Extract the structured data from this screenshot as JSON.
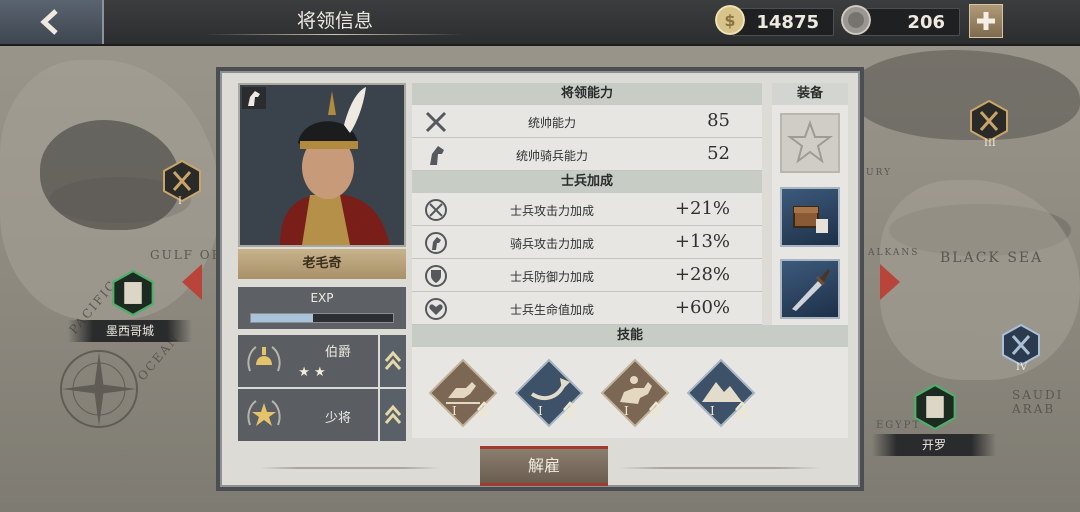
{
  "header": {
    "title": "将领信息"
  },
  "resources": {
    "gold": "14875",
    "silver": "206"
  },
  "cities": [
    {
      "label": "墨西哥城"
    },
    {
      "label": "开罗"
    }
  ],
  "map_labels": [
    "GULF OF",
    "BLACK SEA",
    "SAUDI ARAB",
    "PACIFIC",
    "OCEAN",
    "EGYPT",
    "ALKANS",
    "URY"
  ],
  "roman": [
    "I",
    "III",
    "IV"
  ],
  "general": {
    "name": "老毛奇",
    "exp_label": "EXP",
    "exp_progress": 0.44
  },
  "ranks": [
    {
      "label": "伯爵",
      "stars": "★ ★"
    },
    {
      "label": "少将"
    }
  ],
  "sections": {
    "ability": "将领能力",
    "soldier": "士兵加成",
    "skills": "技能",
    "equipment": "装备"
  },
  "abilities": [
    {
      "name": "统帅能力",
      "value": "85",
      "icon": "crossed-swords-icon"
    },
    {
      "name": "统帅骑兵能力",
      "value": "52",
      "icon": "horse-head-icon"
    }
  ],
  "bonuses": [
    {
      "name": "士兵攻击力加成",
      "value": "+21%",
      "icon": "swords-circle-icon"
    },
    {
      "name": "骑兵攻击力加成",
      "value": "+13%",
      "icon": "horse-circle-icon"
    },
    {
      "name": "士兵防御力加成",
      "value": "+28%",
      "icon": "shield-circle-icon"
    },
    {
      "name": "士兵生命值加成",
      "value": "+60%",
      "icon": "heart-circle-icon"
    }
  ],
  "skills": [
    {
      "level": "I",
      "icon": "cavalry-charge-icon"
    },
    {
      "level": "I",
      "icon": "flank-arrow-icon"
    },
    {
      "level": "I",
      "icon": "horseman-icon"
    },
    {
      "level": "I",
      "icon": "mountain-icon"
    }
  ],
  "buttons": {
    "dismiss": "解雇"
  }
}
